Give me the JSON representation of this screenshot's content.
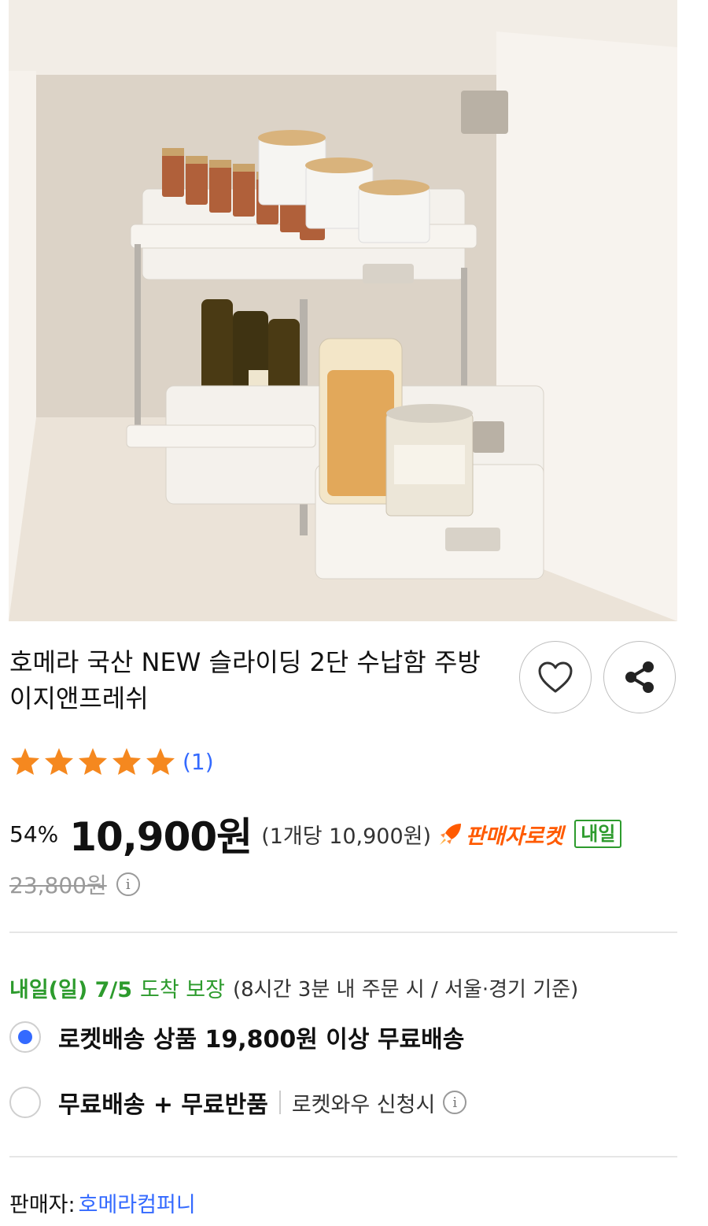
{
  "product": {
    "title": "호메라 국산 NEW 슬라이딩 2단 수납함 주방 이지앤프레쉬",
    "image_icon": "cabinet-organizer-photo",
    "wish_icon": "heart-outline-icon",
    "share_icon": "share-icon"
  },
  "rating": {
    "stars": 5,
    "max_stars": 5,
    "count": "(1)",
    "star_color": "#f5881f"
  },
  "price": {
    "discount": "54%",
    "sale": "10,900원",
    "unit": "(1개당 10,900원)",
    "rocket_label": "판매자로켓",
    "tomorrow_badge": "내일",
    "original": "23,800원",
    "info_symbol": "i"
  },
  "delivery": {
    "date": "내일(일) 7/5",
    "guarantee": "도착 보장",
    "note": "(8시간 3분 내 주문 시 / 서울·경기 기준)",
    "options": [
      {
        "label": "로켓배송 상품 19,800원 이상 무료배송",
        "selected": true
      },
      {
        "label": "무료배송 + 무료반품",
        "sub": "로켓와우 신청시",
        "selected": false
      }
    ]
  },
  "seller": {
    "label": "판매자:",
    "name": "호메라컴퍼니"
  },
  "colors": {
    "accent_blue": "#346aff",
    "green": "#2d9b2d",
    "rocket_orange": "#ff5a00"
  }
}
